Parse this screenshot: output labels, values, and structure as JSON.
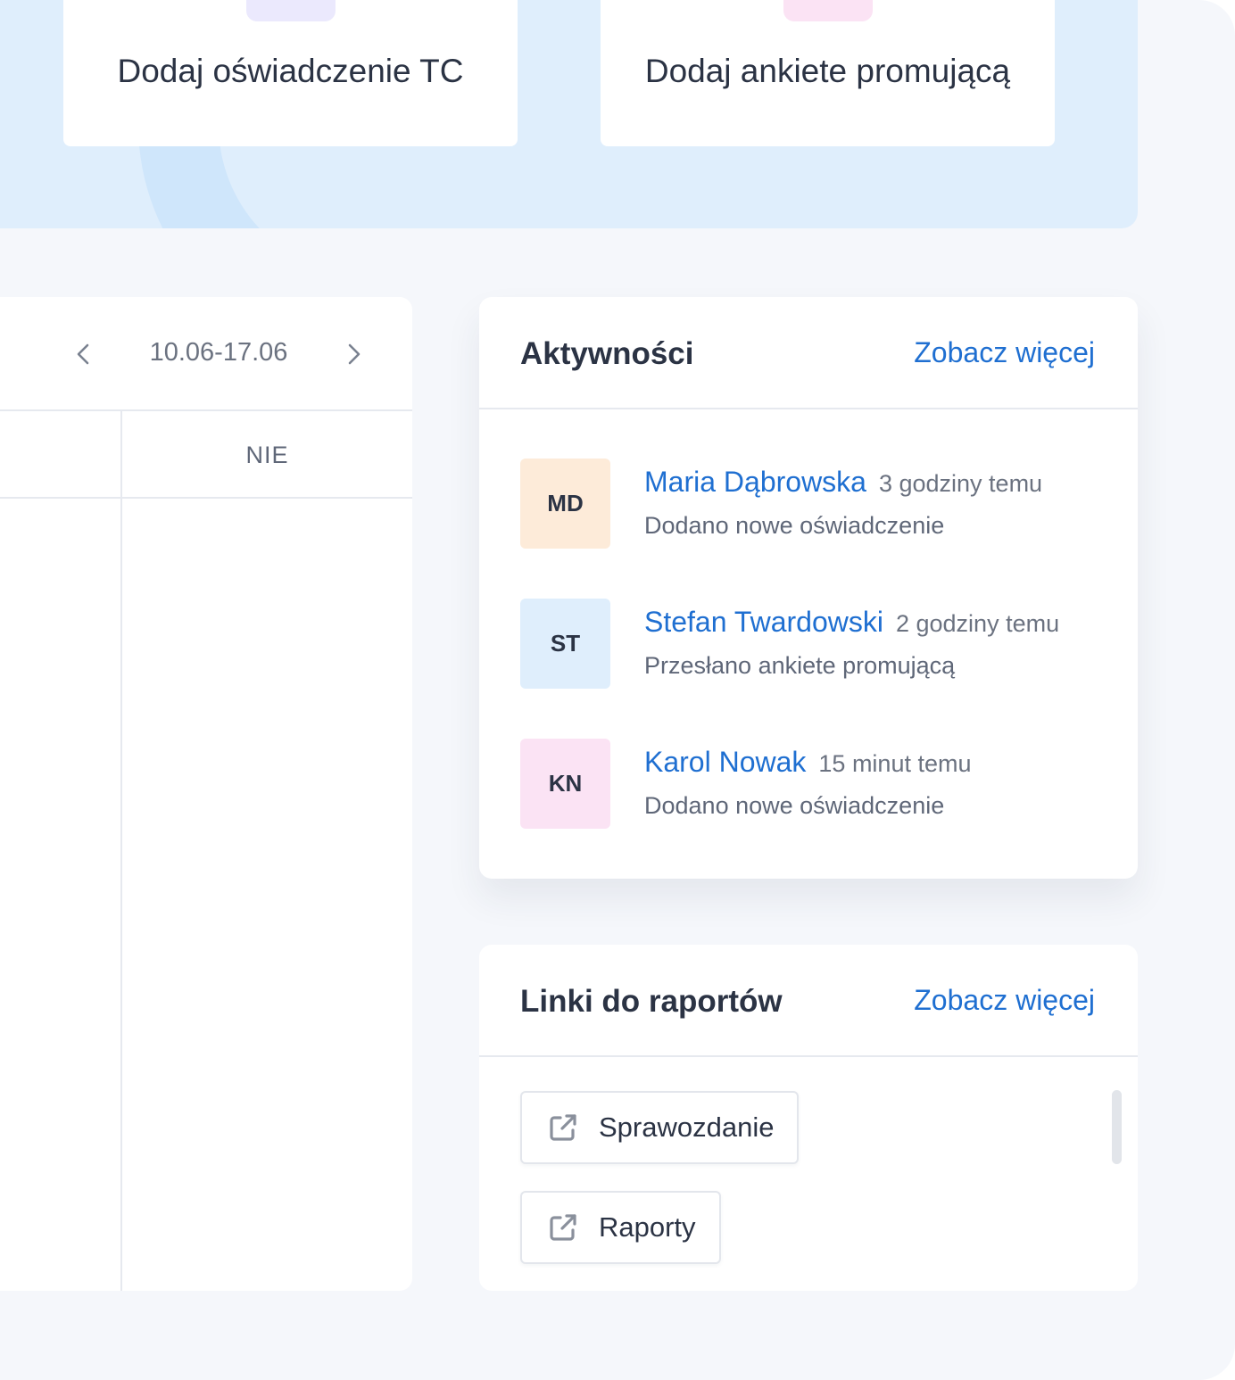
{
  "actions": {
    "tc_label": "Dodaj oświadczenie TC",
    "ankieta_label": "Dodaj ankiete promującą"
  },
  "calendar": {
    "range": "10.06-17.06",
    "day_label": "NIE",
    "prev_icon": "chevron-left-icon",
    "next_icon": "chevron-right-icon"
  },
  "activities": {
    "title": "Aktywności",
    "more_label": "Zobacz więcej",
    "items": [
      {
        "initials": "MD",
        "name": "Maria Dąbrowska",
        "time": "3 godziny temu",
        "description": "Dodano nowe oświadczenie",
        "avatar_color": "#fdebd9"
      },
      {
        "initials": "ST",
        "name": "Stefan Twardowski",
        "time": "2 godziny temu",
        "description": "Przesłano ankiete promującą",
        "avatar_color": "#dfeefc"
      },
      {
        "initials": "KN",
        "name": "Karol Nowak",
        "time": "15 minut temu",
        "description": "Dodano nowe oświadczenie",
        "avatar_color": "#fbe3f4"
      }
    ]
  },
  "reports": {
    "title": "Linki do raportów",
    "more_label": "Zobacz więcej",
    "links": [
      {
        "label": "Sprawozdanie",
        "icon": "external-link-icon"
      },
      {
        "label": "Raporty",
        "icon": "external-link-icon"
      }
    ]
  },
  "colors": {
    "accent": "#1f6fd1",
    "banner": "#dfeefc",
    "background": "#f5f7fb"
  }
}
